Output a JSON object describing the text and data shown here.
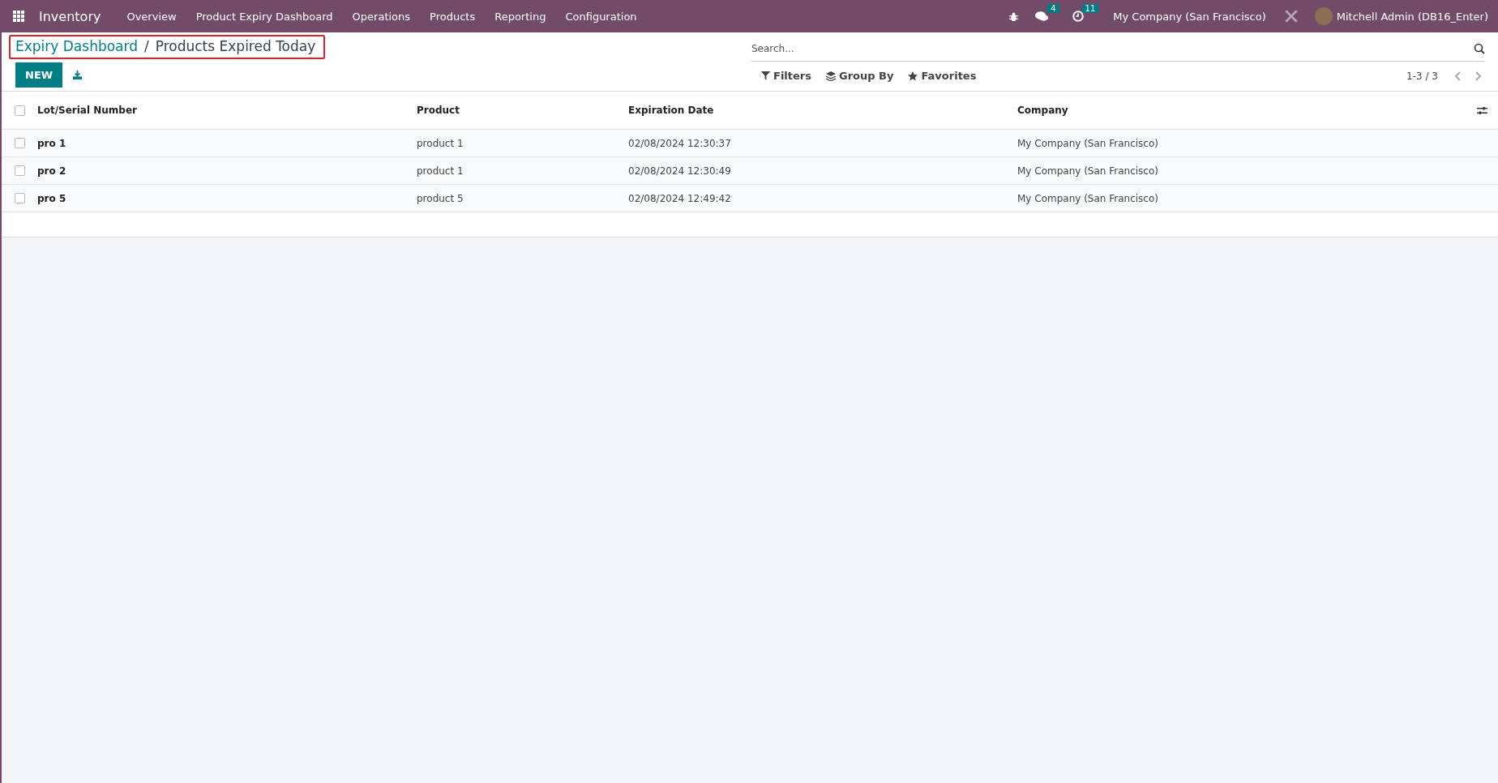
{
  "navbar": {
    "app_name": "Inventory",
    "menu": [
      "Overview",
      "Product Expiry Dashboard",
      "Operations",
      "Products",
      "Reporting",
      "Configuration"
    ],
    "messages_count": "4",
    "activities_count": "11",
    "company": "My Company (San Francisco)",
    "user": "Mitchell Admin (DB16_Enter)"
  },
  "breadcrumb": {
    "parent": "Expiry Dashboard",
    "separator": "/",
    "current": "Products Expired Today",
    "highlighted": true
  },
  "actions": {
    "new_button": "NEW"
  },
  "search": {
    "placeholder": "Search..."
  },
  "filters": [
    "Filters",
    "Group By",
    "Favorites"
  ],
  "pager": {
    "text": "1-3 / 3"
  },
  "table": {
    "select_all_checked": false,
    "columns": [
      "Lot/Serial Number",
      "Product",
      "Expiration Date",
      "Company"
    ],
    "rows": [
      {
        "cells": [
          "pro 1",
          "product 1",
          "02/08/2024 12:30:37",
          "My Company (San Francisco)"
        ],
        "selected": false
      },
      {
        "cells": [
          "pro 2",
          "product 1",
          "02/08/2024 12:30:49",
          "My Company (San Francisco)"
        ],
        "selected": false
      },
      {
        "cells": [
          "pro 5",
          "product 5",
          "02/08/2024 12:49:42",
          "My Company (San Francisco)"
        ],
        "selected": false
      }
    ]
  }
}
